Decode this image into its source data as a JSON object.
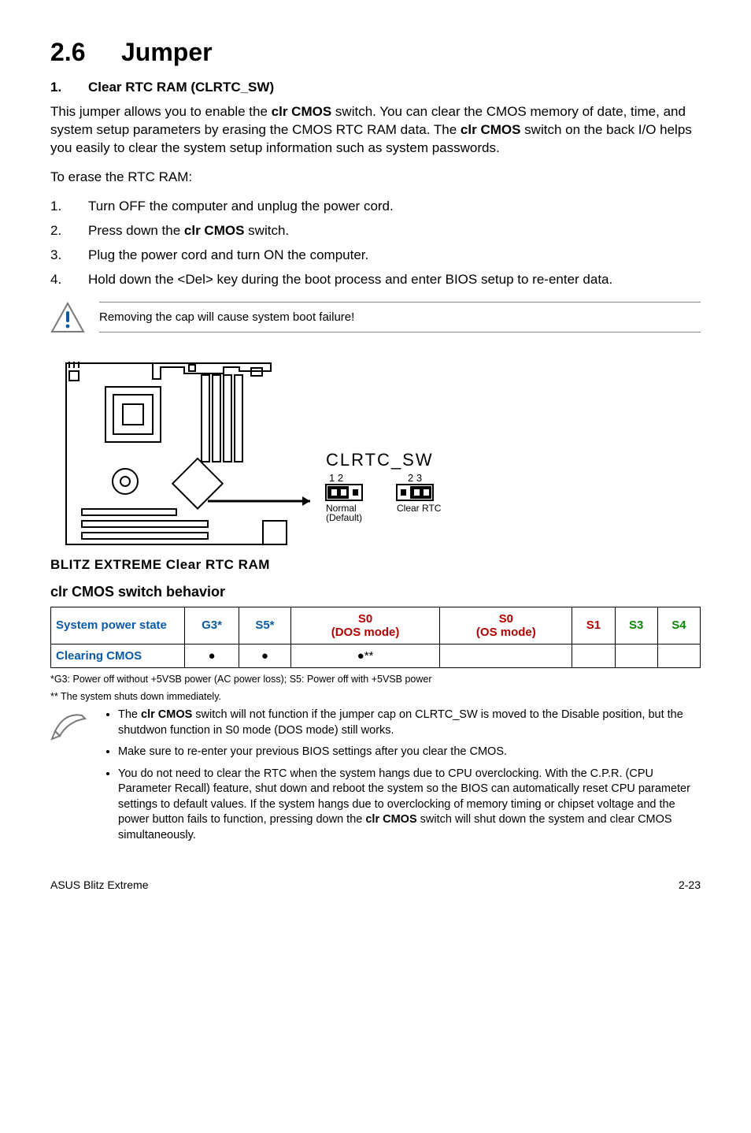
{
  "title_num": "2.6",
  "title_text": "Jumper",
  "sub1_num": "1.",
  "sub1_text": "Clear RTC RAM (CLRTC_SW)",
  "intro_html": "This jumper allows you to enable the <b>clr CMOS</b> switch. You can clear the CMOS memory of date, time, and system setup parameters by erasing the CMOS RTC RAM data. The <b>clr CMOS</b> switch on the back I/O helps you easily to clear the system setup information such as system passwords.",
  "erase_line": "To erase the RTC RAM:",
  "steps": [
    "Turn OFF the computer and unplug the power cord.",
    "Press down the <b>clr CMOS</b> switch.",
    "Plug the power cord and turn ON the computer.",
    "Hold down the <Del> key during the boot process and enter BIOS setup to re-enter data."
  ],
  "warning": "Removing the cap will cause system boot failure!",
  "diagram": {
    "pin_label": "CLRTC_SW",
    "left_pins": "1 2",
    "right_pins": "2 3",
    "left_mode": "Normal",
    "left_sub": "(Default)",
    "right_mode": "Clear RTC",
    "caption": "BLITZ EXTREME Clear RTC RAM"
  },
  "behavior_heading": "clr CMOS switch behavior",
  "table": {
    "head_rowlabel": "System power state",
    "cols": [
      {
        "cls": "blue",
        "txt": "G3*"
      },
      {
        "cls": "blue",
        "txt": "S5*"
      },
      {
        "cls": "red",
        "txt": "S0",
        "sub": "(DOS mode)"
      },
      {
        "cls": "red",
        "txt": "S0",
        "sub": "(OS mode)"
      },
      {
        "cls": "red",
        "txt": "S1"
      },
      {
        "cls": "green",
        "txt": "S3"
      },
      {
        "cls": "green",
        "txt": "S4"
      }
    ],
    "row_label": "Clearing CMOS",
    "row": [
      "●",
      "●",
      "●**",
      "",
      "",
      "",
      ""
    ]
  },
  "table_footnote1": "*G3: Power off without +5VSB power (AC power loss); S5: Power off with +5VSB power",
  "table_footnote2": "** The system shuts down immediately.",
  "notes": [
    "The <b>clr CMOS</b> switch will not function if the jumper cap on CLRTC_SW is moved to the Disable position, but the shutdwon function in S0 mode (DOS mode) still works.",
    "Make sure to re-enter your previous BIOS settings after you clear the CMOS.",
    "You do not need to clear the RTC when the system hangs due to CPU overclocking. With the C.P.R. (CPU Parameter Recall) feature, shut down and reboot the system so the BIOS can automatically reset CPU parameter settings to default values. If the system hangs due to overclocking of memory timing or chipset voltage and the power button fails to function, pressing down the <b>clr CMOS</b> switch will shut down the system and clear CMOS simultaneously."
  ],
  "footer_left": "ASUS Blitz Extreme",
  "footer_right": "2-23"
}
